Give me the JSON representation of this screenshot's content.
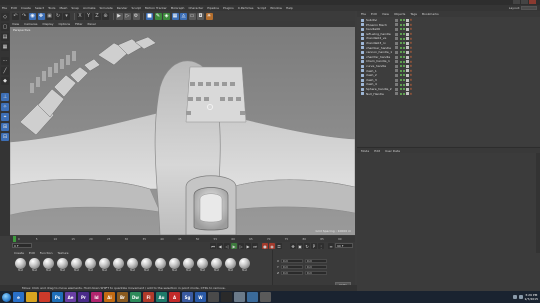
{
  "menubar": {
    "items": [
      "File",
      "Edit",
      "Create",
      "Select",
      "Tools",
      "Mesh",
      "Snap",
      "Animate",
      "Simulate",
      "Render",
      "Sculpt",
      "Motion Tracker",
      "MoGraph",
      "Character",
      "Pipeline",
      "Plugins",
      "X-Particles",
      "Script",
      "Window",
      "Help"
    ],
    "layout_label": "Layout:"
  },
  "viewport": {
    "menu": [
      "View",
      "Cameras",
      "Display",
      "Options",
      "Filter",
      "Panel"
    ],
    "camera_label": "Perspective",
    "grid_label": "Grid Spacing : 10000 m"
  },
  "object_manager": {
    "menu": [
      "File",
      "Edit",
      "View",
      "Objects",
      "Tags",
      "Bookmarks"
    ],
    "objects": [
      {
        "name": "Subdivi"
      },
      {
        "name": "Phoenix Mech"
      },
      {
        "name": "handle06"
      },
      {
        "name": "left-wing_handle"
      },
      {
        "name": "rhandle02_ve"
      },
      {
        "name": "rhandle03_rv"
      },
      {
        "name": "chamber_handle"
      },
      {
        "name": "cannon_handle_1"
      },
      {
        "name": "chamfer_handle"
      },
      {
        "name": "Chem_handle_1"
      },
      {
        "name": "curve_handle"
      },
      {
        "name": "rlash_1"
      },
      {
        "name": "rlash_2"
      },
      {
        "name": "rlash_3"
      },
      {
        "name": "rlash_4"
      },
      {
        "name": "Sphere_handle_2"
      },
      {
        "name": "Null_Handle"
      }
    ]
  },
  "attribute_manager": {
    "menu": [
      "Mode",
      "Edit",
      "User Data"
    ]
  },
  "timeline": {
    "ticks": [
      "0",
      "5",
      "10",
      "15",
      "20",
      "25",
      "30",
      "35",
      "40",
      "45",
      "50",
      "55",
      "60",
      "65",
      "70",
      "75",
      "80",
      "85",
      "90"
    ],
    "current_frame": "0 F",
    "end_frame": "90 F"
  },
  "material_manager": {
    "menu": [
      "Create",
      "Edit",
      "Function",
      "Texture"
    ],
    "materials": [
      "Mat",
      "Mat",
      "Mat",
      "Mat",
      "Mat",
      "Mat",
      "Mat",
      "Mat",
      "Mat",
      "Mat",
      "Mat",
      "Mat",
      "Mat",
      "Mat",
      "Mat",
      "Mat",
      "Mat"
    ]
  },
  "coordinates": {
    "rows": [
      {
        "axis": "X",
        "pos": "0 m",
        "size": "0 m"
      },
      {
        "axis": "Y",
        "pos": "0 m",
        "size": "0 m"
      },
      {
        "axis": "Z",
        "pos": "0 m",
        "size": "0 m"
      }
    ],
    "apply_label": "Apply"
  },
  "status": {
    "text": "Move: Click and drag to move elements. Hold down SHIFT to quantize movement / add to the selection in point mode, CTRL to remove."
  },
  "taskbar": {
    "apps": [
      {
        "label": "e",
        "color": "#2a70c8"
      },
      {
        "label": "",
        "color": "#d8a420"
      },
      {
        "label": "",
        "color": "#cc3a2a"
      },
      {
        "label": "Ps",
        "color": "#1f6fb8"
      },
      {
        "label": "Ae",
        "color": "#6a3fa5"
      },
      {
        "label": "Pr",
        "color": "#4a2b8a"
      },
      {
        "label": "Id",
        "color": "#b0256e"
      },
      {
        "label": "Ai",
        "color": "#c26a12"
      },
      {
        "label": "Br",
        "color": "#8a5a20"
      },
      {
        "label": "Dw",
        "color": "#2d8a5a"
      },
      {
        "label": "Fl",
        "color": "#b03a2a"
      },
      {
        "label": "Au",
        "color": "#1e7a6a"
      },
      {
        "label": "A",
        "color": "#c22a2a"
      },
      {
        "label": "Sg",
        "color": "#3a5aa0"
      },
      {
        "label": "W",
        "color": "#2a5aa8"
      },
      {
        "label": "",
        "color": "#4a4a4a"
      },
      {
        "label": "",
        "color": "#2a2a2a"
      },
      {
        "label": "",
        "color": "#6a7a8a"
      },
      {
        "label": "",
        "color": "#3a6a9a"
      },
      {
        "label": "",
        "color": "#5a5a5a"
      }
    ],
    "time": "3:29 PM",
    "date": "1/7/2015"
  }
}
